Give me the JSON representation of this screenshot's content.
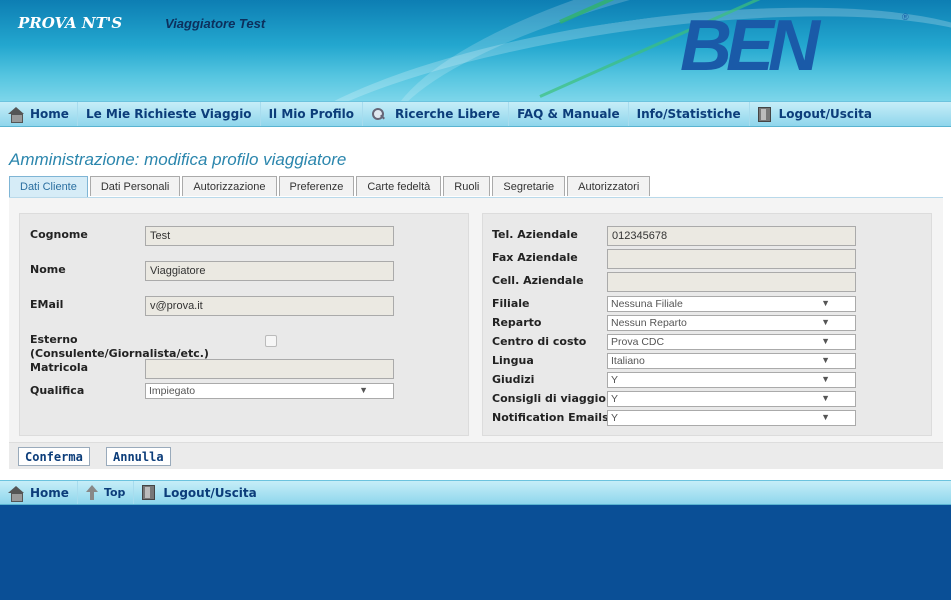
{
  "header": {
    "brand": "PROVA NT'S",
    "user_name": "Viaggiatore Test",
    "logo_text": "BEN"
  },
  "top_nav": {
    "items": [
      {
        "label": "Home",
        "icon": "house-icon"
      },
      {
        "label": "Le Mie Richieste Viaggio"
      },
      {
        "label": "Il Mio Profilo"
      },
      {
        "label": "Ricerche Libere",
        "icon": "magnifier-icon"
      },
      {
        "label": "FAQ & Manuale"
      },
      {
        "label": "Info/Statistiche"
      },
      {
        "label": "Logout/Uscita",
        "icon": "door-icon"
      }
    ]
  },
  "page": {
    "title": "Amministrazione: modifica profilo viaggiatore"
  },
  "tabs": [
    {
      "label": "Dati Cliente",
      "active": true
    },
    {
      "label": "Dati Personali"
    },
    {
      "label": "Autorizzazione"
    },
    {
      "label": "Preferenze"
    },
    {
      "label": "Carte fedeltà"
    },
    {
      "label": "Ruoli"
    },
    {
      "label": "Segretarie"
    },
    {
      "label": "Autorizzatori"
    }
  ],
  "left_form": {
    "cognome_label": "Cognome",
    "cognome_value": "Test",
    "nome_label": "Nome",
    "nome_value": "Viaggiatore",
    "email_label": "EMail",
    "email_value": "v@prova.it",
    "esterno_label_1": "Esterno",
    "esterno_label_2": "(Consulente/Giornalista/etc.)",
    "matricola_label": "Matricola",
    "matricola_value": "",
    "qualifica_label": "Qualifica",
    "qualifica_value": "Impiegato"
  },
  "right_form": {
    "tel_label": "Tel. Aziendale",
    "tel_value": "012345678",
    "fax_label": "Fax Aziendale",
    "fax_value": "",
    "cell_label": "Cell. Aziendale",
    "cell_value": "",
    "filiale_label": "Filiale",
    "filiale_value": "Nessuna Filiale",
    "reparto_label": "Reparto",
    "reparto_value": "Nessun Reparto",
    "cdc_label": "Centro di costo",
    "cdc_value": "Prova CDC",
    "lingua_label": "Lingua",
    "lingua_value": "Italiano",
    "giudizi_label": "Giudizi",
    "giudizi_value": "Y",
    "consigli_label": "Consigli di viaggio",
    "consigli_value": "Y",
    "notif_label": "Notification Emails",
    "notif_value": "Y"
  },
  "buttons": {
    "confirm": "Conferma",
    "cancel": "Annulla"
  },
  "bottom_nav": {
    "items": [
      {
        "label": "Home",
        "icon": "house-icon"
      },
      {
        "label": "Top",
        "icon": "arrow-up-icon"
      },
      {
        "label": "Logout/Uscita",
        "icon": "door-icon"
      }
    ]
  },
  "colors": {
    "header_blue": "#0d7eb3",
    "nav_bg": "#8fd6ec",
    "nav_text": "#0c3d7a",
    "title_text": "#2b86ad",
    "footer_blue": "#0a4f96"
  }
}
